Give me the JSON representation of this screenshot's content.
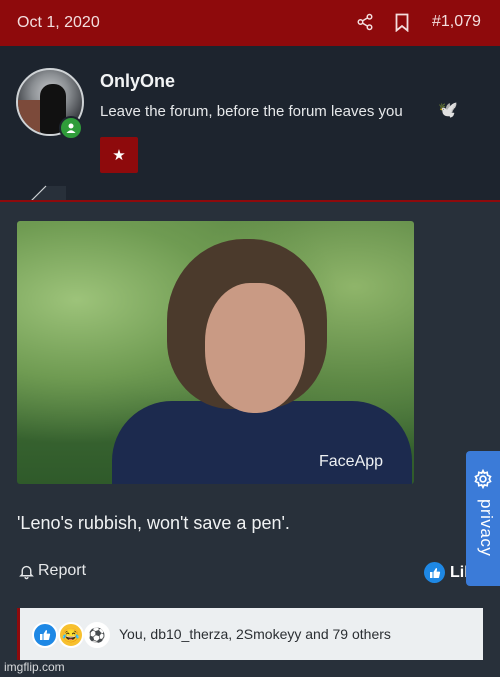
{
  "header": {
    "date": "Oct 1, 2020",
    "post_number": "#1,079"
  },
  "user": {
    "name": "OnlyOne",
    "title": "Leave the forum, before the forum leaves you",
    "title_emoji": "🕊️"
  },
  "post": {
    "image_watermark": "FaceApp",
    "text": "'Leno's rubbish, won't save a pen'.",
    "report_label": "Report",
    "like_label": "Lil"
  },
  "reactions": {
    "summary": "You, db10_therza, 2Smokeyy and 79 others"
  },
  "privacy": {
    "label": "privacy"
  },
  "footer": {
    "watermark": "imgflip.com"
  },
  "colors": {
    "accent": "#8e0a0c",
    "background": "#1d242e",
    "post_bg": "#28303a",
    "like_blue": "#1e88e5",
    "privacy_blue": "#3b7bd8"
  }
}
